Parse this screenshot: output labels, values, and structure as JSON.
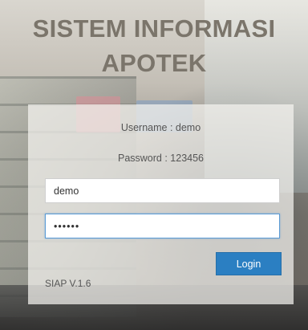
{
  "header": {
    "title_line1": "SISTEM INFORMASI",
    "title_line2": "APOTEK"
  },
  "login": {
    "username_hint": "Username : demo",
    "password_hint": "Password : 123456",
    "username_value": "demo",
    "password_value": "••••••",
    "login_label": "Login",
    "version": "SIAP V.1.6"
  },
  "colors": {
    "title": "#7b756b",
    "button": "#2b7fc2",
    "focus_border": "#5b9bd5"
  }
}
